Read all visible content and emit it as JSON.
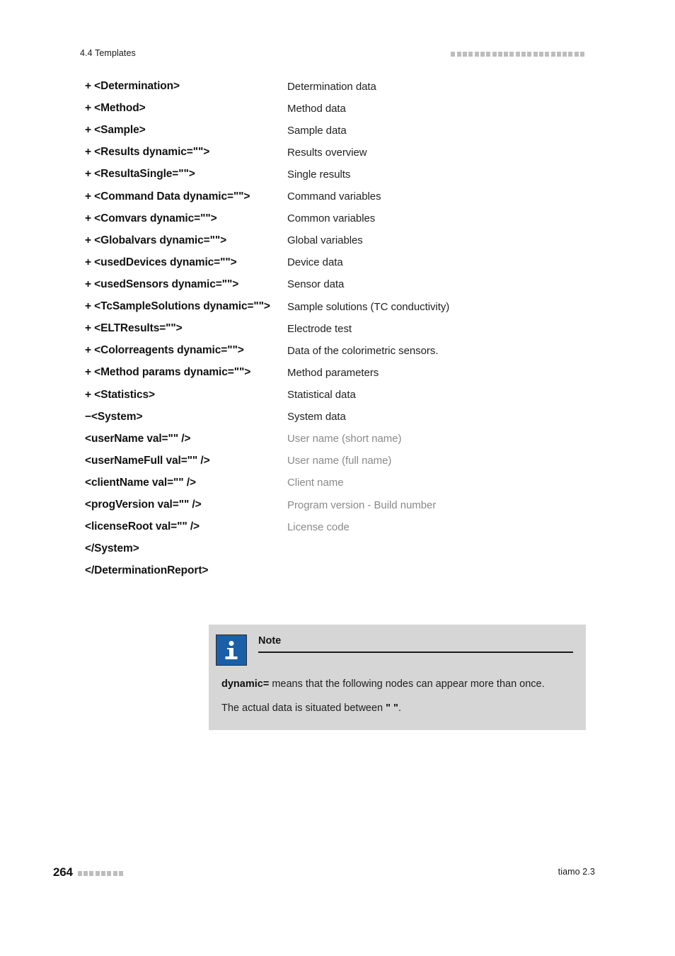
{
  "header": {
    "section_label": "4.4 Templates",
    "decor_block_count": 23,
    "decor_block_color": "#bdbdbd"
  },
  "entries": [
    {
      "tag": "+ <Determination>",
      "desc": "Determination data",
      "level": "main"
    },
    {
      "tag": "+ <Method>",
      "desc": "Method data",
      "level": "main"
    },
    {
      "tag": "+ <Sample>",
      "desc": "Sample data",
      "level": "main"
    },
    {
      "tag": "+ <Results dynamic=\"\">",
      "desc": "Results overview",
      "level": "main"
    },
    {
      "tag": "+ <ResultaSingle=\"\">",
      "desc": "Single results",
      "level": "main"
    },
    {
      "tag": "+ <Command Data dynamic=\"\">",
      "desc": "Command variables",
      "level": "main"
    },
    {
      "tag": "+ <Comvars dynamic=\"\">",
      "desc": "Common variables",
      "level": "main"
    },
    {
      "tag": "+ <Globalvars dynamic=\"\">",
      "desc": "Global variables",
      "level": "main"
    },
    {
      "tag": "+ <usedDevices dynamic=\"\">",
      "desc": "Device data",
      "level": "main"
    },
    {
      "tag": "+ <usedSensors dynamic=\"\">",
      "desc": "Sensor data",
      "level": "main"
    },
    {
      "tag": "+ <TcSampleSolutions dynamic=\"\">",
      "desc": "Sample solutions (TC conductivity)",
      "level": "main"
    },
    {
      "tag": "+ <ELTResults=\"\">",
      "desc": "Electrode test",
      "level": "main"
    },
    {
      "tag": "+ <Colorreagents dynamic=\"\">",
      "desc": "Data of the colorimetric sensors.",
      "level": "main"
    },
    {
      "tag": "+ <Method params dynamic=\"\">",
      "desc": "Method parameters",
      "level": "main"
    },
    {
      "tag": "+ <Statistics>",
      "desc": "Statistical data",
      "level": "main"
    },
    {
      "tag": "−<System>",
      "desc": "System data",
      "level": "main"
    },
    {
      "tag": "<userName val=\"\" />",
      "desc": "User name (short name)",
      "level": "sub"
    },
    {
      "tag": "<userNameFull val=\"\" />",
      "desc": "User name (full name)",
      "level": "sub"
    },
    {
      "tag": "<clientName val=\"\" />",
      "desc": "Client name",
      "level": "sub"
    },
    {
      "tag": "<progVersion val=\"\" />",
      "desc": "Program version - Build number",
      "level": "sub"
    },
    {
      "tag": "<licenseRoot val=\"\" />",
      "desc": "License code",
      "level": "sub"
    },
    {
      "tag": "</System>",
      "desc": "",
      "level": "main"
    },
    {
      "tag": "</DeterminationReport>",
      "desc": "",
      "level": "main"
    }
  ],
  "note": {
    "icon_name": "info-icon",
    "icon_color": "#1a5fa8",
    "background_color": "#d6d6d6",
    "title": "Note",
    "paragraph_1_bold": "dynamic=",
    "paragraph_1_rest": " means that the following nodes can appear more than once.",
    "paragraph_2_before": "The actual data is situated between ",
    "paragraph_2_bold": "\" \"",
    "paragraph_2_after": "."
  },
  "footer": {
    "page_number": "264",
    "decor_block_count": 8,
    "decor_block_color": "#bdbdbd",
    "product": "tiamo 2.3"
  }
}
